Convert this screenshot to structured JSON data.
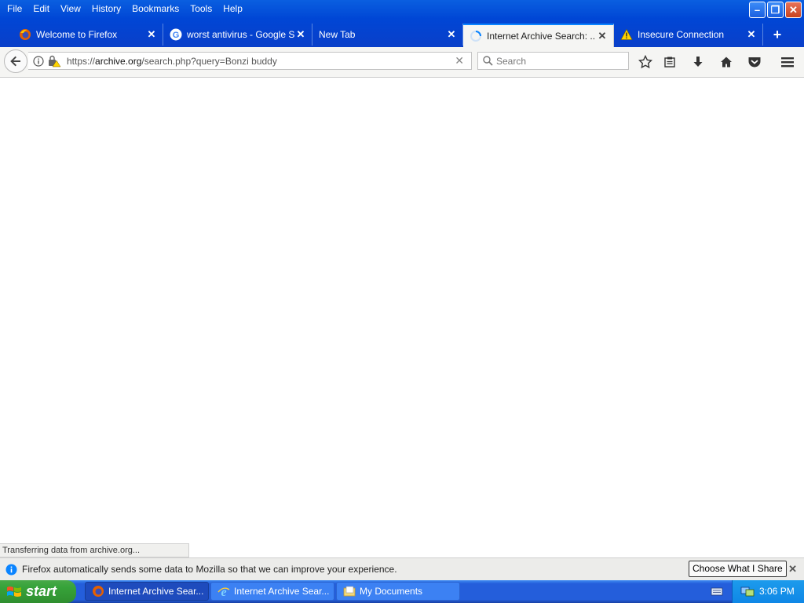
{
  "menu": [
    "File",
    "Edit",
    "View",
    "History",
    "Bookmarks",
    "Tools",
    "Help"
  ],
  "tabs": [
    {
      "label": "Welcome to Firefox",
      "icon": "firefox-icon",
      "active": false
    },
    {
      "label": "worst antivirus - Google S...",
      "icon": "google-icon",
      "active": false
    },
    {
      "label": "New Tab",
      "icon": "",
      "active": false
    },
    {
      "label": "Internet Archive Search: ...",
      "icon": "loading-spinner-icon",
      "active": true
    },
    {
      "label": "Insecure Connection",
      "icon": "warning-icon",
      "active": false
    }
  ],
  "url": {
    "prefix": "https://",
    "host": "archive.org",
    "path": "/search.php?query=Bonzi buddy"
  },
  "search": {
    "placeholder": "Search"
  },
  "status": "Transferring data from archive.org...",
  "notification": {
    "message": "Firefox automatically sends some data to Mozilla so that we can improve your experience.",
    "button": "Choose What I Share"
  },
  "taskbar": {
    "start": "start",
    "tasks": [
      {
        "label": "Internet Archive Sear...",
        "icon": "firefox-icon"
      },
      {
        "label": "Internet Archive Sear...",
        "icon": "ie-icon"
      },
      {
        "label": "My Documents",
        "icon": "folder-icon"
      }
    ],
    "clock": "3:06 PM"
  }
}
